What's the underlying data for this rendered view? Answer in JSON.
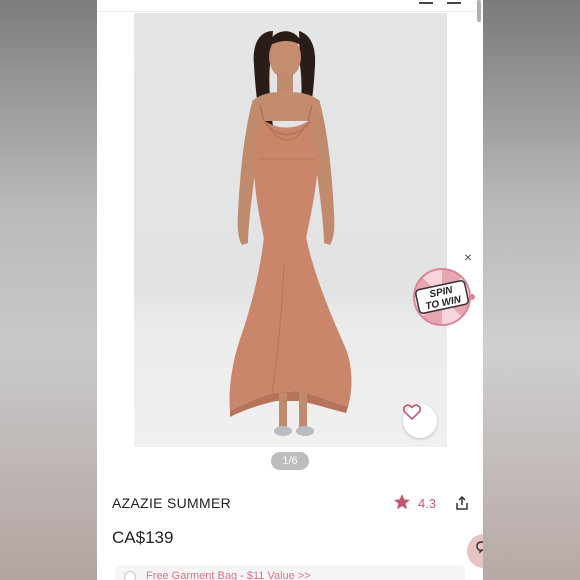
{
  "gallery": {
    "counter": "1/6"
  },
  "promo_wheel": {
    "close_label": "×",
    "line1": "SPIN",
    "line2": "TO WIN"
  },
  "product": {
    "name": "AZAZIE SUMMER",
    "rating": "4.3",
    "price": "CA$139"
  },
  "promo_banner": {
    "text": "Free Garment Bag - $11 Value >>"
  },
  "icons": {
    "wishlist": "heart-icon",
    "rating": "star-icon",
    "share": "share-icon",
    "chat": "chat-icon",
    "close": "close-icon"
  },
  "colors": {
    "accent": "#c0596c",
    "promo_text": "#d77486",
    "dress": "#c9866b",
    "wheel": "#e6a7b3"
  }
}
